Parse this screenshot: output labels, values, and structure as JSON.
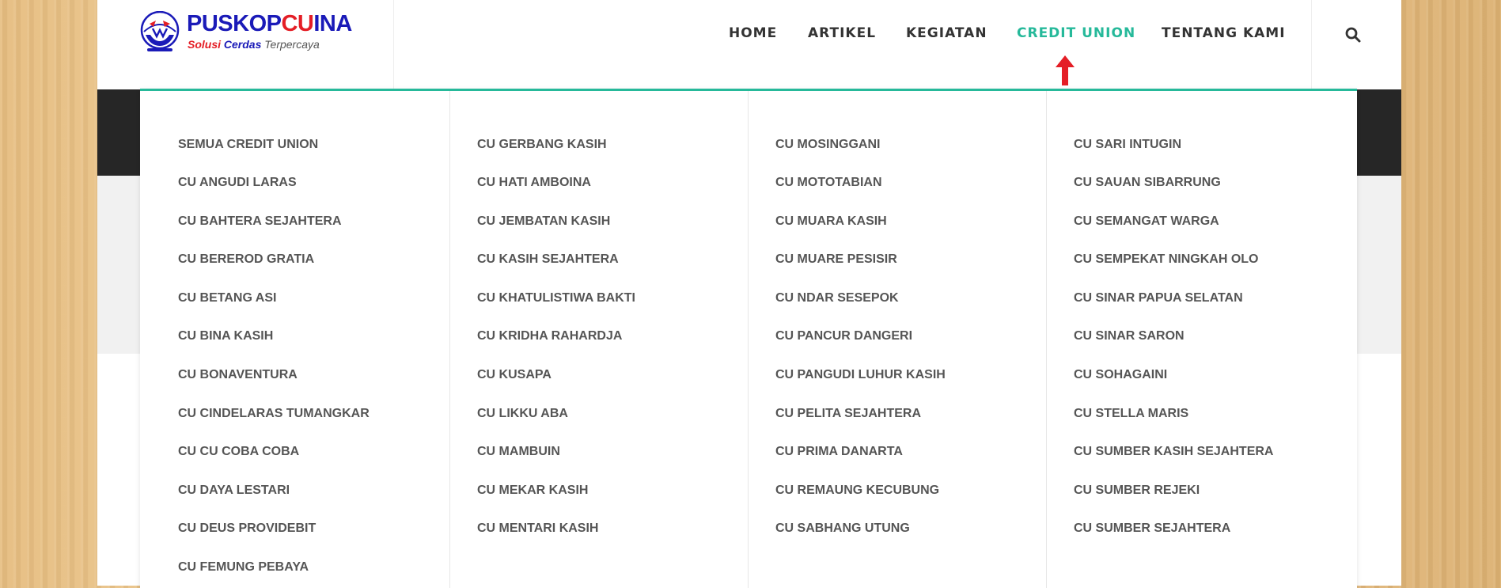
{
  "logo": {
    "name_part1": "PUSKOP",
    "name_part2": "CU",
    "name_part3": "INA",
    "tagline_part1": "Solusi",
    "tagline_part2": "Cerdas",
    "tagline_part3": "Terpercaya"
  },
  "nav": {
    "items": [
      {
        "label": "HOME"
      },
      {
        "label": "ARTIKEL"
      },
      {
        "label": "KEGIATAN"
      },
      {
        "label": "CREDIT UNION"
      },
      {
        "label": "TENTANG KAMI"
      }
    ],
    "active_item": "CREDIT UNION",
    "search_icon": "search-icon"
  },
  "colors": {
    "accent": "#26b99a",
    "arrow": "#e41e26",
    "brand_blue": "#1a1ab8",
    "brand_red": "#e41e26"
  },
  "dropdown": {
    "columns": [
      [
        "SEMUA CREDIT UNION",
        "CU ANGUDI LARAS",
        "CU BAHTERA SEJAHTERA",
        "CU BEREROD GRATIA",
        "CU BETANG ASI",
        "CU BINA KASIH",
        "CU BONAVENTURA",
        "CU CINDELARAS TUMANGKAR",
        "CU CU COBA COBA",
        "CU DAYA LESTARI",
        "CU DEUS PROVIDEBIT",
        "CU FEMUNG PEBAYA"
      ],
      [
        "CU GERBANG KASIH",
        "CU HATI AMBOINA",
        "CU JEMBATAN KASIH",
        "CU KASIH SEJAHTERA",
        "CU KHATULISTIWA BAKTI",
        "CU KRIDHA RAHARDJA",
        "CU KUSAPA",
        "CU LIKKU ABA",
        "CU MAMBUIN",
        "CU MEKAR KASIH",
        "CU MENTARI KASIH"
      ],
      [
        "CU MOSINGGANI",
        "CU MOTOTABIAN",
        "CU MUARA KASIH",
        "CU MUARE PESISIR",
        "CU NDAR SESEPOK",
        "CU PANCUR DANGERI",
        "CU PANGUDI LUHUR KASIH",
        "CU PELITA SEJAHTERA",
        "CU PRIMA DANARTA",
        "CU REMAUNG KECUBUNG",
        "CU SABHANG UTUNG"
      ],
      [
        "CU SARI INTUGIN",
        "CU SAUAN SIBARRUNG",
        "CU SEMANGAT WARGA",
        "CU SEMPEKAT NINGKAH OLO",
        "CU SINAR PAPUA SELATAN",
        "CU SINAR SARON",
        "CU SOHAGAINI",
        "CU STELLA MARIS",
        "CU SUMBER KASIH SEJAHTERA",
        "CU SUMBER REJEKI",
        "CU SUMBER SEJAHTERA"
      ]
    ]
  }
}
